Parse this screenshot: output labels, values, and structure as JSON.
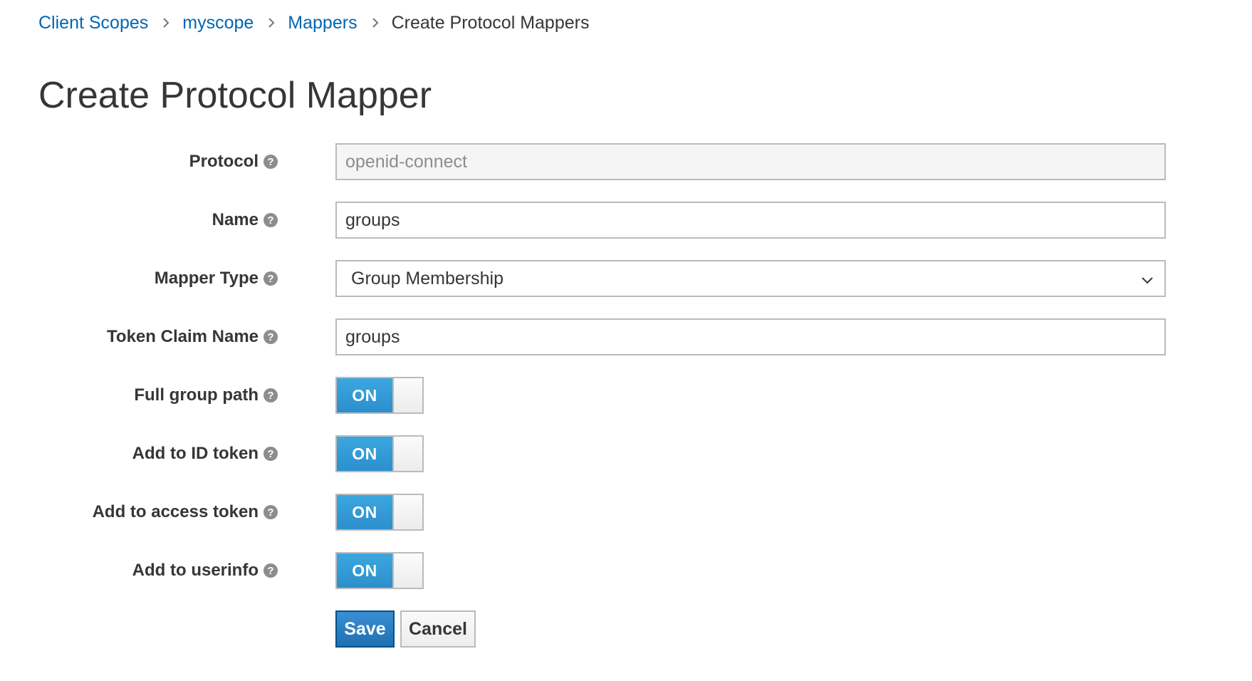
{
  "breadcrumb": {
    "items": [
      {
        "label": "Client Scopes"
      },
      {
        "label": "myscope"
      },
      {
        "label": "Mappers"
      }
    ],
    "current": "Create Protocol Mappers"
  },
  "page": {
    "title": "Create Protocol Mapper"
  },
  "form": {
    "protocol": {
      "label": "Protocol",
      "value": "openid-connect"
    },
    "name": {
      "label": "Name",
      "value": "groups"
    },
    "mapper_type": {
      "label": "Mapper Type",
      "value": "Group Membership"
    },
    "token_claim_name": {
      "label": "Token Claim Name",
      "value": "groups"
    },
    "full_group_path": {
      "label": "Full group path",
      "state": "ON"
    },
    "add_to_id_token": {
      "label": "Add to ID token",
      "state": "ON"
    },
    "add_to_access_token": {
      "label": "Add to access token",
      "state": "ON"
    },
    "add_to_userinfo": {
      "label": "Add to userinfo",
      "state": "ON"
    }
  },
  "actions": {
    "save_label": "Save",
    "cancel_label": "Cancel"
  },
  "icons": {
    "help": "?"
  }
}
